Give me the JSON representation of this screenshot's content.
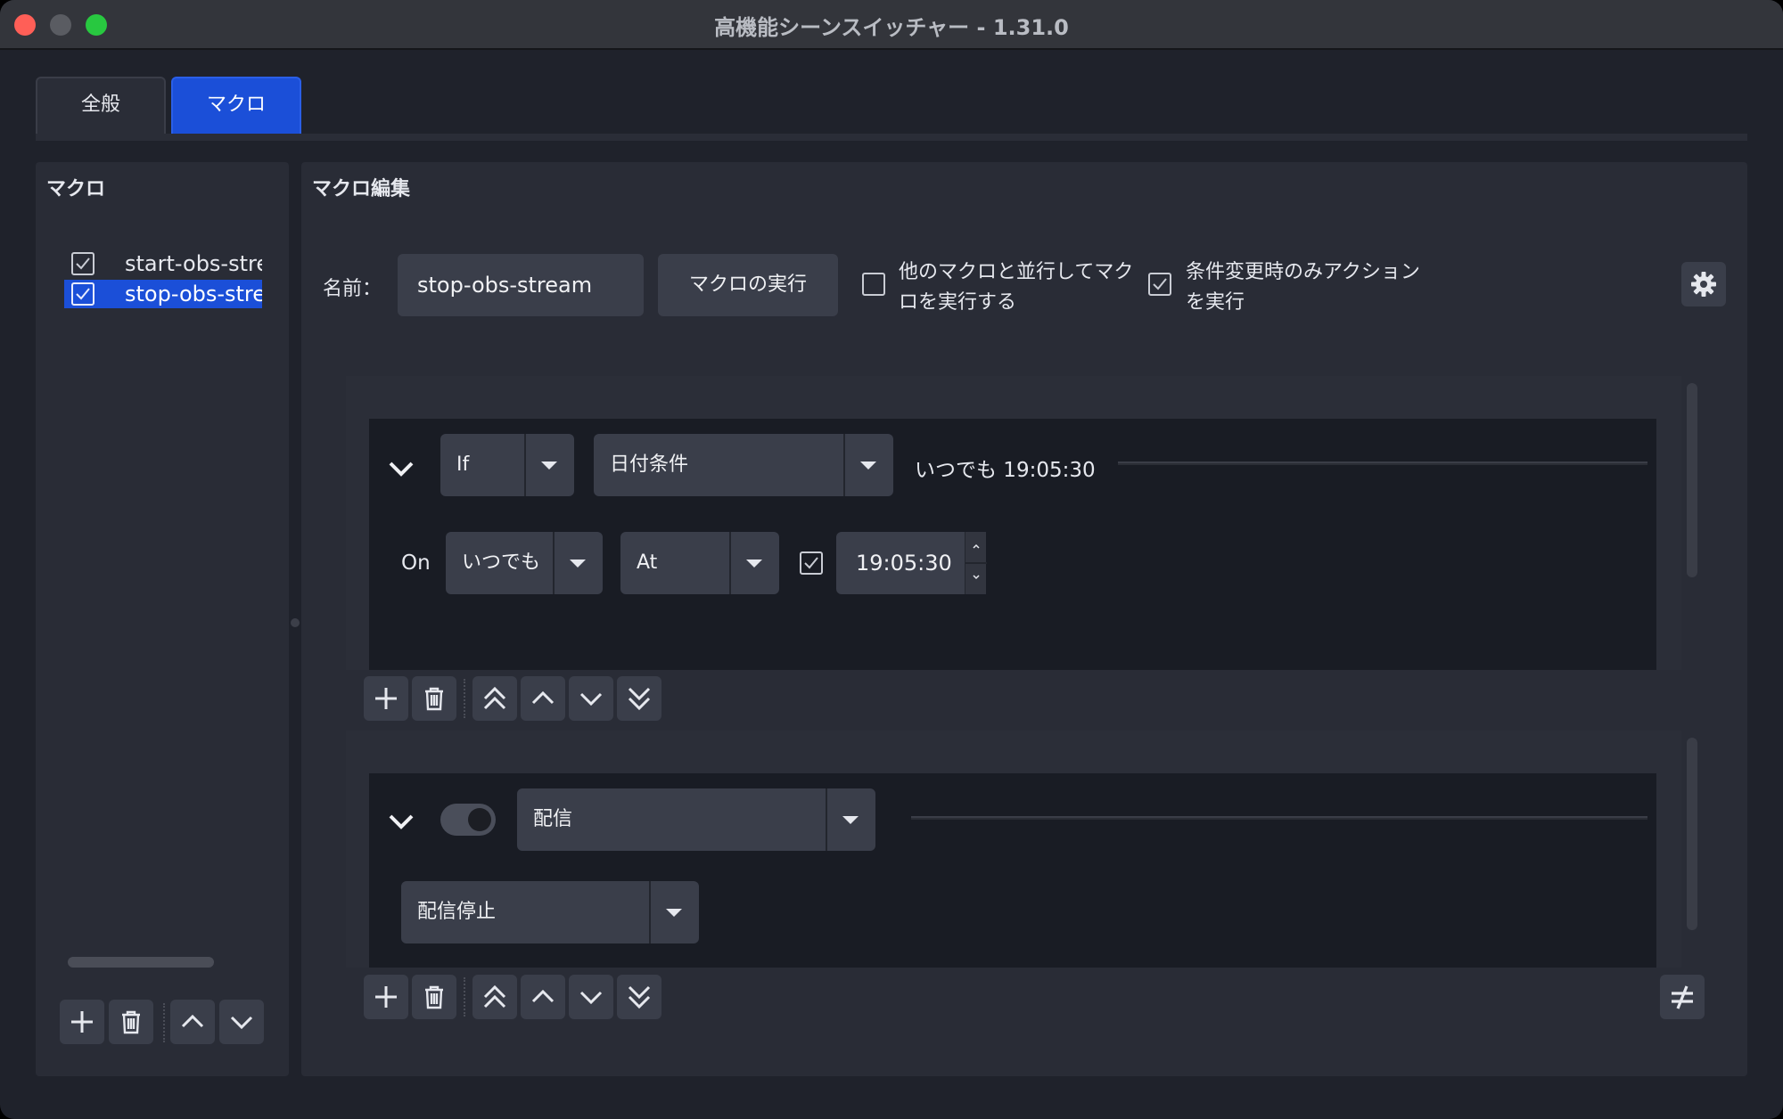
{
  "window": {
    "title": "高機能シーンスイッチャー - 1.31.0"
  },
  "tabs": [
    {
      "label": "全般",
      "active": false
    },
    {
      "label": "マクロ",
      "active": true
    }
  ],
  "macro_list": {
    "title": "マクロ",
    "items": [
      {
        "label": "start-obs-stream",
        "checked": true,
        "selected": false
      },
      {
        "label": "stop-obs-stream",
        "checked": true,
        "selected": true
      }
    ]
  },
  "editor": {
    "title": "マクロ編集",
    "name_label": "名前：",
    "name_value": "stop-obs-stream",
    "run_button": "マクロの実行",
    "parallel_option": {
      "line1": "他のマクロと並行してマク",
      "line2": "ロを実行する",
      "checked": false
    },
    "on_change_option": {
      "line1": "条件変更時のみアクション",
      "line2": "を実行",
      "checked": true
    }
  },
  "condition": {
    "logic": "If",
    "type": "日付条件",
    "summary": "いつでも 19:05:30",
    "on_label": "On",
    "day": "いつでも",
    "mode": "At",
    "time_enabled": true,
    "time": "19:05:30"
  },
  "action": {
    "enabled": false,
    "type": "配信",
    "subtype": "配信停止"
  },
  "icons": {
    "settings": "gear-icon",
    "add": "plus-icon",
    "remove": "trash-icon",
    "top": "double-chevron-up-icon",
    "up": "chevron-up-icon",
    "down": "chevron-down-icon",
    "bottom": "double-chevron-down-icon",
    "toggle_else": "not-equal-icon"
  },
  "colors": {
    "accent": "#1b4fd8",
    "window_bg": "#1f222b",
    "panel_bg": "#292c36",
    "card_bg": "#191c24",
    "control_bg": "#3a3e4a"
  }
}
